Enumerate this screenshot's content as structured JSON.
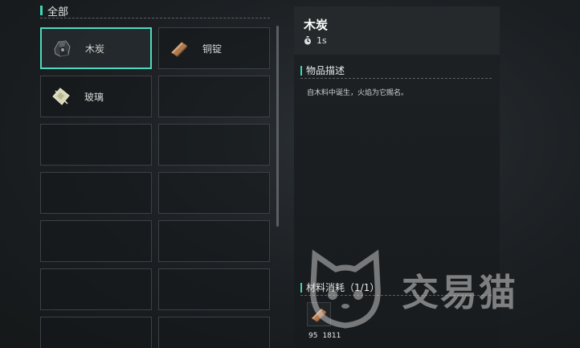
{
  "category": {
    "label": "全部"
  },
  "items": [
    {
      "name": "木炭",
      "icon": "charcoal-icon",
      "selected": true
    },
    {
      "name": "铜锭",
      "icon": "copper-ingot-icon",
      "selected": false
    },
    {
      "name": "玻璃",
      "icon": "glass-icon",
      "selected": false
    },
    {
      "name": "",
      "icon": "",
      "selected": false
    },
    {
      "name": "",
      "icon": "",
      "selected": false
    },
    {
      "name": "",
      "icon": "",
      "selected": false
    },
    {
      "name": "",
      "icon": "",
      "selected": false
    },
    {
      "name": "",
      "icon": "",
      "selected": false
    },
    {
      "name": "",
      "icon": "",
      "selected": false
    },
    {
      "name": "",
      "icon": "",
      "selected": false
    },
    {
      "name": "",
      "icon": "",
      "selected": false
    },
    {
      "name": "",
      "icon": "",
      "selected": false
    },
    {
      "name": "",
      "icon": "",
      "selected": false
    },
    {
      "name": "",
      "icon": "",
      "selected": false
    }
  ],
  "detail": {
    "title": "木炭",
    "time": "1s",
    "description_title": "物品描述",
    "description": "自木料中诞生，火焰为它赐名。",
    "materials_title": "材料消耗（1/1）",
    "material": {
      "icon": "copper-ingot-icon",
      "required": "95",
      "owned": "1811"
    }
  },
  "watermark": {
    "text": "交易猫"
  },
  "colors": {
    "accent": "#43d3b4",
    "selected_border": "#4fd9c0"
  }
}
